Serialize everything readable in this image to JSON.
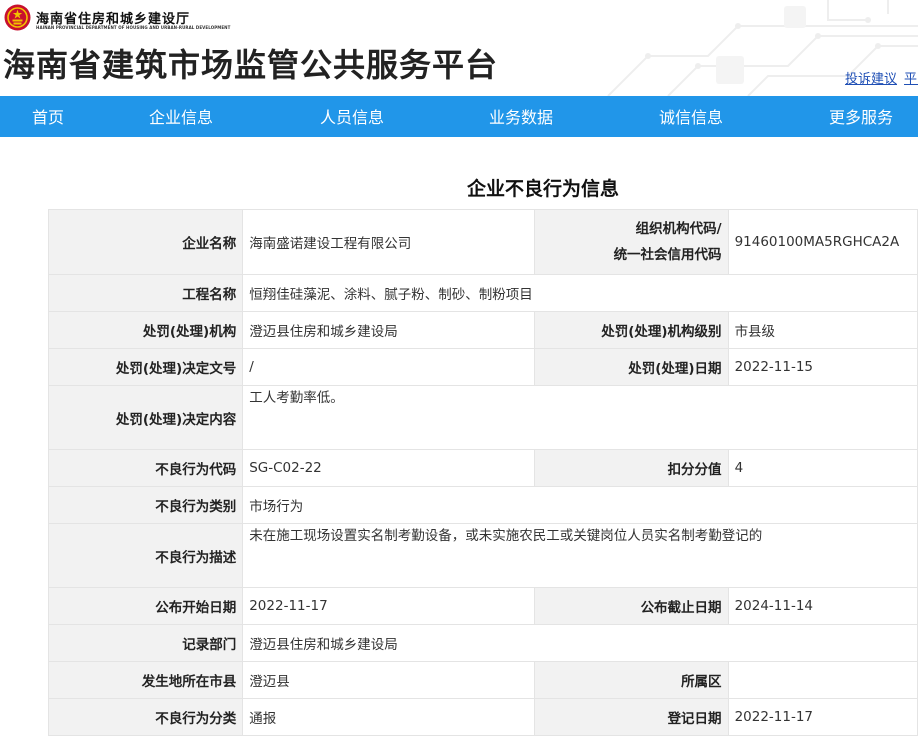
{
  "header": {
    "dept_name_cn": "海南省住房和城乡建设厅",
    "dept_name_en": "HAINAN PROVINCIAL DEPARTMENT OF HOUSING AND URBAN-RURAL DEVELOPMENT",
    "site_title": "海南省建筑市场监管公共服务平台",
    "links": [
      "投诉建议",
      "平台"
    ]
  },
  "nav": {
    "items": [
      "首页",
      "企业信息",
      "人员信息",
      "业务数据",
      "诚信信息",
      "更多服务"
    ]
  },
  "main": {
    "title": "企业不良行为信息",
    "fields": {
      "company_name": {
        "label": "企业名称",
        "value": "海南盛诺建设工程有限公司"
      },
      "org_code": {
        "label_line1": "组织机构代码/",
        "label_line2": "统一社会信用代码",
        "value": "91460100MA5RGHCA2A"
      },
      "project_name": {
        "label": "工程名称",
        "value": "恒翔佳硅藻泥、涂料、腻子粉、制砂、制粉项目"
      },
      "penalty_org": {
        "label": "处罚(处理)机构",
        "value": "澄迈县住房和城乡建设局"
      },
      "penalty_org_level": {
        "label": "处罚(处理)机构级别",
        "value": "市县级"
      },
      "decision_no": {
        "label": "处罚(处理)决定文号",
        "value": "/"
      },
      "penalty_date": {
        "label": "处罚(处理)日期",
        "value": "2022-11-15"
      },
      "decision_content": {
        "label": "处罚(处理)决定内容",
        "value": "工人考勤率低。"
      },
      "behavior_code": {
        "label": "不良行为代码",
        "value": "SG-C02-22"
      },
      "deduction": {
        "label": "扣分分值",
        "value": "4"
      },
      "behavior_category": {
        "label": "不良行为类别",
        "value": "市场行为"
      },
      "behavior_desc": {
        "label": "不良行为描述",
        "value": "未在施工现场设置实名制考勤设备，或未实施农民工或关键岗位人员实名制考勤登记的"
      },
      "publish_start": {
        "label": "公布开始日期",
        "value": "2022-11-17"
      },
      "publish_end": {
        "label": "公布截止日期",
        "value": "2024-11-14"
      },
      "record_dept": {
        "label": "记录部门",
        "value": "澄迈县住房和城乡建设局"
      },
      "city": {
        "label": "发生地所在市县",
        "value": "澄迈县"
      },
      "district": {
        "label": "所属区",
        "value": ""
      },
      "classification": {
        "label": "不良行为分类",
        "value": "通报"
      },
      "register_date": {
        "label": "登记日期",
        "value": "2022-11-17"
      }
    }
  },
  "colors": {
    "nav_bg": "#2196e9",
    "label_bg": "#f2f2f2",
    "border": "#e4e4e4",
    "link": "#1f4fb5"
  }
}
